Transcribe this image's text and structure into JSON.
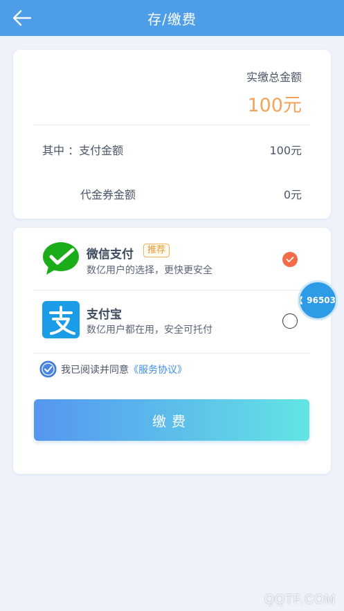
{
  "header": {
    "title": "存/缴费",
    "back_icon": "arrow-left-icon"
  },
  "summary": {
    "total_label": "实缴总金额",
    "total_amount": "100元",
    "payment_label": "其中 ：支付金额",
    "payment_value": "100元",
    "voucher_label": "代金券金额",
    "voucher_value": "0元"
  },
  "methods": [
    {
      "name": "微信支付",
      "badge": "推荐",
      "desc": "数亿用户的选择，更快更安全",
      "icon": "wechat-pay-icon",
      "selected": true
    },
    {
      "name": "支付宝",
      "desc": "数亿用户都在用，安全可托付",
      "icon": "alipay-icon",
      "selected": false
    }
  ],
  "agreement": {
    "text": "我已阅读并同意",
    "link": "《服务协议》",
    "checked": true
  },
  "pay_button": {
    "label": "缴费"
  },
  "hotline": {
    "number": "96503",
    "icon": "phone-icon"
  },
  "watermark": "QQTF.COM",
  "colors": {
    "header": "#4d9de8",
    "accent_orange": "#f5a35a",
    "radio_selected": "#f26b4a",
    "link": "#3b8ee8"
  }
}
